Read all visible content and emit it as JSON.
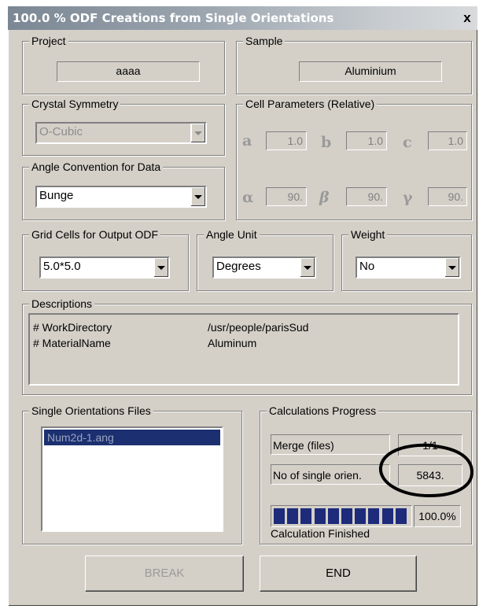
{
  "window": {
    "title": "100.0 % ODF Creations from Single Orientations",
    "close_glyph": "x"
  },
  "project": {
    "label": "Project",
    "value": "aaaa"
  },
  "sample": {
    "label": "Sample",
    "value": "Aluminium"
  },
  "crystal_symmetry": {
    "label": "Crystal Symmetry",
    "value": "O-Cubic"
  },
  "cell_parameters": {
    "label": "Cell Parameters (Relative)",
    "a": {
      "symbol": "a",
      "value": "1.0"
    },
    "b": {
      "symbol": "b",
      "value": "1.0"
    },
    "c": {
      "symbol": "c",
      "value": "1.0"
    },
    "alpha": {
      "symbol": "α",
      "value": "90."
    },
    "beta": {
      "symbol": "β",
      "value": "90."
    },
    "gamma": {
      "symbol": "γ",
      "value": "90."
    }
  },
  "angle_convention": {
    "label": "Angle Convention for Data",
    "value": "Bunge"
  },
  "grid_cells": {
    "label": "Grid Cells for Output ODF",
    "value": "5.0*5.0"
  },
  "angle_unit": {
    "label": "Angle Unit",
    "value": "Degrees"
  },
  "weight": {
    "label": "Weight",
    "value": "No"
  },
  "descriptions": {
    "label": "Descriptions",
    "lines": [
      {
        "key": "# WorkDirectory",
        "value": "/usr/people/parisSud"
      },
      {
        "key": "# MaterialName",
        "value": "Aluminum"
      }
    ]
  },
  "single_orientation_files": {
    "label": "Single Orientations Files",
    "items": [
      "Num2d-1.ang"
    ]
  },
  "calc_progress": {
    "label": "Calculations Progress",
    "merge_label": "Merge (files)",
    "merge_value": "1/1",
    "orien_label": "No of single orien.",
    "orien_value": "5843.",
    "percent_text": "100.0%",
    "progress_fraction": 1.0,
    "status": "Calculation Finished"
  },
  "buttons": {
    "break_label": "BREAK",
    "end_label": "END"
  }
}
